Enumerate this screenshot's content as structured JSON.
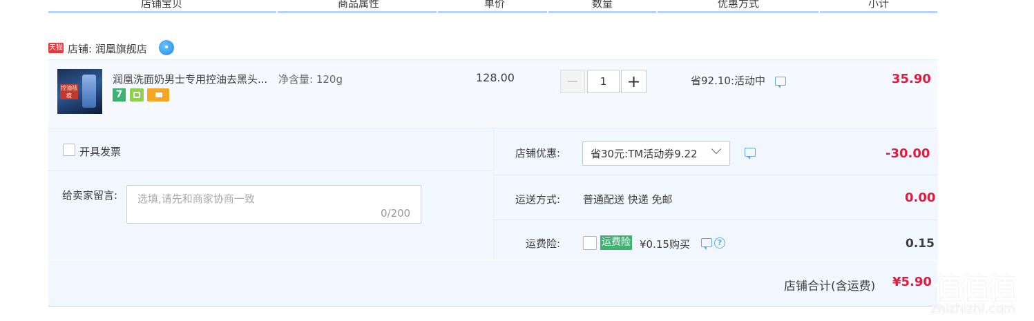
{
  "header": {
    "columns": [
      "店铺宝贝",
      "商品属性",
      "单价",
      "数量",
      "优惠方式",
      "小计"
    ]
  },
  "shop": {
    "badge": "天猫",
    "name": "店铺: 润凰旗舰店"
  },
  "item": {
    "thumb_text": "控油祛痘",
    "title": "润凰洗面奶男士专用控油去黑头...",
    "property": "净含量: 120g",
    "service_badge_7": "7",
    "unit_price": "128.00",
    "quantity": "1",
    "minus": "−",
    "plus": "+",
    "promotion": "省92.10:活动中",
    "subtotal": "35.90"
  },
  "invoice": {
    "label": "开具发票"
  },
  "message": {
    "label": "给卖家留言:",
    "placeholder": "选填,请先和商家协商一致",
    "counter": "0/200"
  },
  "shop_discount": {
    "label": "店铺优惠:",
    "selected": "省30元:TM活动券9.22",
    "amount": "-30.00"
  },
  "shipping": {
    "label": "运送方式:",
    "method": "普通配送 快递 免邮",
    "amount": "0.00"
  },
  "insurance": {
    "label": "运费险:",
    "badge": "运费险",
    "price_text": "¥0.15购买",
    "help": "?",
    "amount": "0.15"
  },
  "total": {
    "label": "店铺合计(含运费)",
    "amount": "¥5.90"
  },
  "watermark": {
    "logo": "值值值",
    "site": "zhizhizhi.com"
  },
  "colors": {
    "price_red": "#e4193c",
    "panel_bg": "#f2f7ff",
    "header_line": "#b2d1ff",
    "tmall_red": "#e4393c",
    "link_blue": "#5aa8e8",
    "badge_green": "#3cb371"
  }
}
